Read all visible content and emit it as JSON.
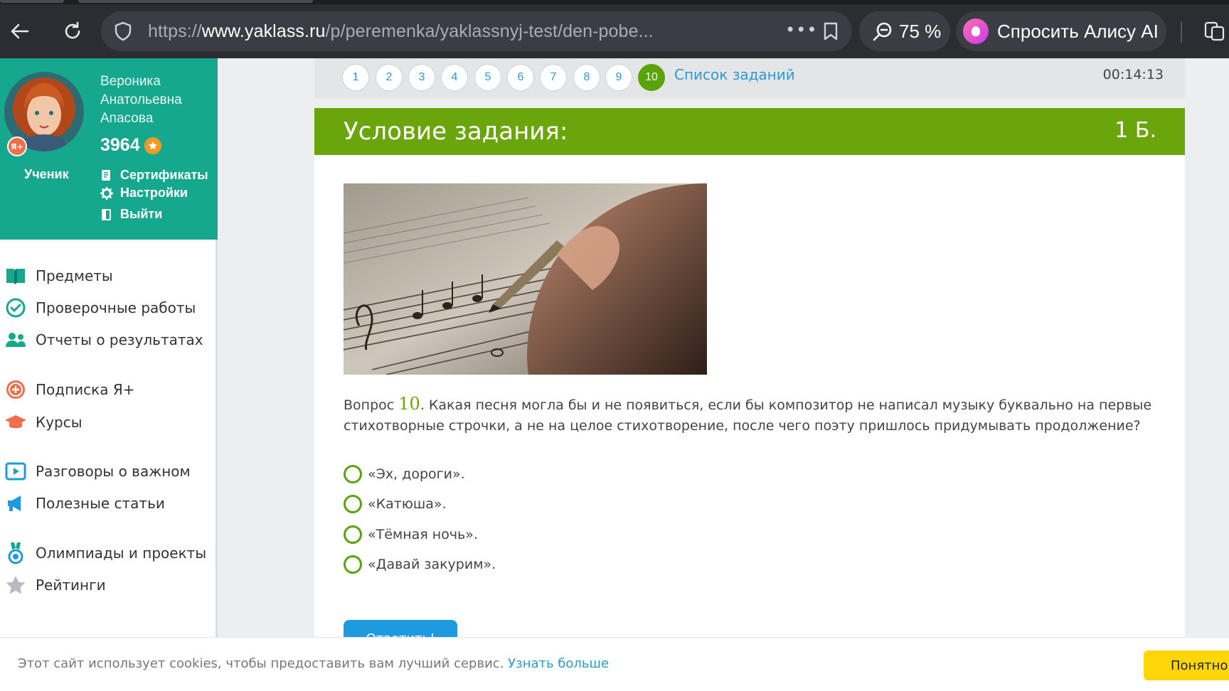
{
  "browser": {
    "url_scheme": "https://",
    "url_domain": "www.yaklass.ru",
    "url_path": "/p/peremenka/yaklassnyj-test/den-pobe...",
    "zoom": "75 %",
    "alice_button": "Спросить Алису AI"
  },
  "profile": {
    "name_line1": "Вероника",
    "name_line2": "Анатольевна",
    "name_line3": "Апасова",
    "points": "3964",
    "badge": "Я+",
    "role": "Ученик",
    "links": {
      "certificates": "Сертификаты",
      "settings": "Настройки",
      "logout": "Выйти"
    }
  },
  "sidebar_menu": [
    {
      "label": "Предметы",
      "icon": "book-icon"
    },
    {
      "label": "Проверочные работы",
      "icon": "check-circle-icon"
    },
    {
      "label": "Отчеты о результатах",
      "icon": "users-icon"
    },
    {
      "label": "Подписка Я+",
      "icon": "ya-plus-icon"
    },
    {
      "label": "Курсы",
      "icon": "graduation-cap-icon"
    },
    {
      "label": "Разговоры о важном",
      "icon": "play-icon"
    },
    {
      "label": "Полезные статьи",
      "icon": "megaphone-icon"
    },
    {
      "label": "Олимпиады и проекты",
      "icon": "medal-icon"
    },
    {
      "label": "Рейтинги",
      "icon": "star-icon"
    }
  ],
  "task_nav": {
    "numbers": [
      "1",
      "2",
      "3",
      "4",
      "5",
      "6",
      "7",
      "8",
      "9",
      "10"
    ],
    "active": "10",
    "list_link": "Список заданий",
    "timer": "00:14:13"
  },
  "task": {
    "header_title": "Условие задания:",
    "points": "1 Б.",
    "question_prefix": "Вопрос ",
    "question_number": "10",
    "question_text": ". Какая песня могла бы и не появиться, если бы композитор не написал музыку буквально на первые стихотворные строчки, а не на целое стихотворение, после чего поэту пришлось придумывать продолжение?",
    "options": [
      "«Эх, дороги».",
      "«Катюша».",
      "«Тёмная ночь».",
      "«Давай закурим»."
    ],
    "answer_button": "Ответить!"
  },
  "cookie": {
    "text": "Этот сайт использует cookies, чтобы предоставить вам лучший сервис.",
    "link": "Узнать больше",
    "button": "Понятно"
  },
  "colors": {
    "teal": "#16a88f",
    "green": "#6aa60b",
    "blue": "#2a9bd3",
    "yellow": "#ffd60a"
  }
}
